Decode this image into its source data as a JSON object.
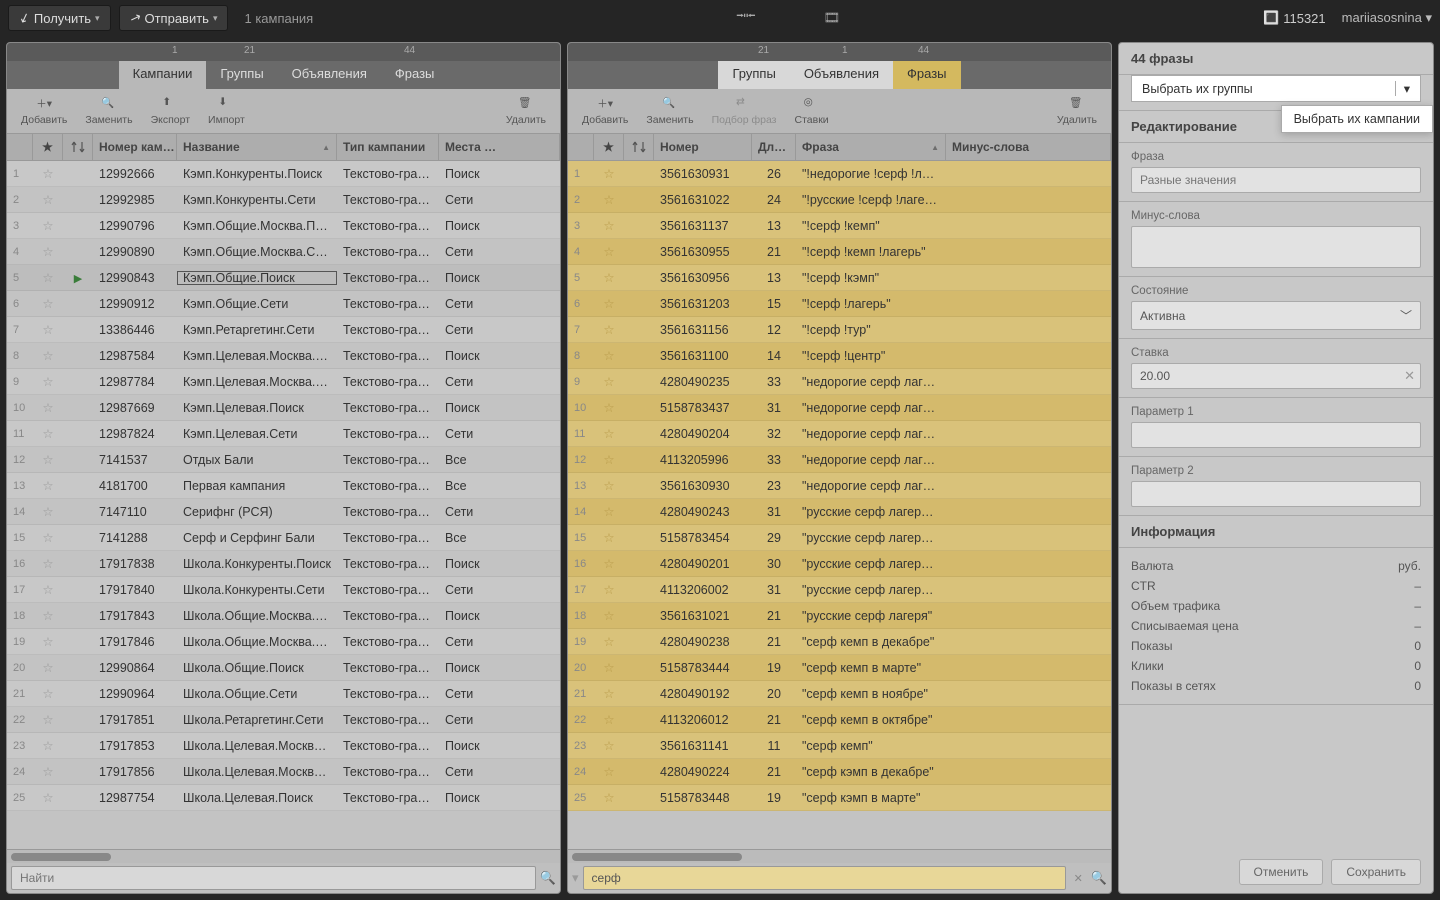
{
  "topbar": {
    "receive": "Получить",
    "send": "Отправить",
    "campaigns_label": "1 кампания",
    "balance": "115321",
    "user": "mariiasosnina"
  },
  "left_counts": {
    "c1": "1",
    "c21": "21",
    "c44": "44"
  },
  "mid_counts": {
    "c21": "21",
    "c1": "1",
    "c44": "44"
  },
  "left_tabs": {
    "campaigns": "Кампании",
    "groups": "Группы",
    "ads": "Объявления",
    "phrases": "Фразы"
  },
  "mid_tabs": {
    "groups": "Группы",
    "ads": "Объявления",
    "phrases": "Фразы"
  },
  "tools": {
    "add": "Добавить",
    "replace": "Заменить",
    "export": "Экспорт",
    "import": "Импорт",
    "delete": "Удалить",
    "pick": "Подбор фраз",
    "bids": "Ставки"
  },
  "left_cols": {
    "num": "Номер кам…",
    "name": "Название",
    "type": "Тип кампании",
    "places": "Места …"
  },
  "mid_cols": {
    "num": "Номер",
    "len": "Дл…",
    "phrase": "Фраза",
    "minus": "Минус-слова"
  },
  "left_rows": [
    {
      "n": "1",
      "id": "12992666",
      "name": "Кэмп.Конкуренты.Поиск",
      "type": "Текстово-граф…",
      "place": "Поиск"
    },
    {
      "n": "2",
      "id": "12992985",
      "name": "Кэмп.Конкуренты.Сети",
      "type": "Текстово-граф…",
      "place": "Сети"
    },
    {
      "n": "3",
      "id": "12990796",
      "name": "Кэмп.Общие.Москва.П…",
      "type": "Текстово-граф…",
      "place": "Поиск"
    },
    {
      "n": "4",
      "id": "12990890",
      "name": "Кэмп.Общие.Москва.С…",
      "type": "Текстово-граф…",
      "place": "Сети"
    },
    {
      "n": "5",
      "id": "12990843",
      "name": "Кэмп.Общие.Поиск",
      "type": "Текстово-граф…",
      "place": "Поиск",
      "sel": true
    },
    {
      "n": "6",
      "id": "12990912",
      "name": "Кэмп.Общие.Сети",
      "type": "Текстово-граф…",
      "place": "Сети"
    },
    {
      "n": "7",
      "id": "13386446",
      "name": "Кэмп.Ретаргетинг.Сети",
      "type": "Текстово-граф…",
      "place": "Сети"
    },
    {
      "n": "8",
      "id": "12987584",
      "name": "Кэмп.Целевая.Москва.…",
      "type": "Текстово-граф…",
      "place": "Поиск"
    },
    {
      "n": "9",
      "id": "12987784",
      "name": "Кэмп.Целевая.Москва.…",
      "type": "Текстово-граф…",
      "place": "Сети"
    },
    {
      "n": "10",
      "id": "12987669",
      "name": "Кэмп.Целевая.Поиск",
      "type": "Текстово-граф…",
      "place": "Поиск"
    },
    {
      "n": "11",
      "id": "12987824",
      "name": "Кэмп.Целевая.Сети",
      "type": "Текстово-граф…",
      "place": "Сети"
    },
    {
      "n": "12",
      "id": "7141537",
      "name": "Отдых Бали",
      "type": "Текстово-граф…",
      "place": "Все"
    },
    {
      "n": "13",
      "id": "4181700",
      "name": "Первая кампания",
      "type": "Текстово-граф…",
      "place": "Все"
    },
    {
      "n": "14",
      "id": "7147110",
      "name": "Серифнг (РСЯ)",
      "type": "Текстово-граф…",
      "place": "Сети"
    },
    {
      "n": "15",
      "id": "7141288",
      "name": "Серф и Серфинг Бали",
      "type": "Текстово-граф…",
      "place": "Все"
    },
    {
      "n": "16",
      "id": "17917838",
      "name": "Школа.Конкуренты.Поиск",
      "type": "Текстово-граф…",
      "place": "Поиск"
    },
    {
      "n": "17",
      "id": "17917840",
      "name": "Школа.Конкуренты.Сети",
      "type": "Текстово-граф…",
      "place": "Сети"
    },
    {
      "n": "18",
      "id": "17917843",
      "name": "Школа.Общие.Москва.…",
      "type": "Текстово-граф…",
      "place": "Поиск"
    },
    {
      "n": "19",
      "id": "17917846",
      "name": "Школа.Общие.Москва.…",
      "type": "Текстово-граф…",
      "place": "Сети"
    },
    {
      "n": "20",
      "id": "12990864",
      "name": "Школа.Общие.Поиск",
      "type": "Текстово-граф…",
      "place": "Поиск"
    },
    {
      "n": "21",
      "id": "12990964",
      "name": "Школа.Общие.Сети",
      "type": "Текстово-граф…",
      "place": "Сети"
    },
    {
      "n": "22",
      "id": "17917851",
      "name": "Школа.Ретаргетинг.Сети",
      "type": "Текстово-граф…",
      "place": "Сети"
    },
    {
      "n": "23",
      "id": "17917853",
      "name": "Школа.Целевая.Москва…",
      "type": "Текстово-граф…",
      "place": "Поиск"
    },
    {
      "n": "24",
      "id": "17917856",
      "name": "Школа.Целевая.Москва…",
      "type": "Текстово-граф…",
      "place": "Сети"
    },
    {
      "n": "25",
      "id": "12987754",
      "name": "Школа.Целевая.Поиск",
      "type": "Текстово-граф…",
      "place": "Поиск"
    }
  ],
  "mid_rows": [
    {
      "n": "1",
      "id": "3561630931",
      "len": "26",
      "phrase": "\"!недорогие !серф !лаге…"
    },
    {
      "n": "2",
      "id": "3561631022",
      "len": "24",
      "phrase": "\"!русские !серф !лагеря\""
    },
    {
      "n": "3",
      "id": "3561631137",
      "len": "13",
      "phrase": "\"!серф !кемп\""
    },
    {
      "n": "4",
      "id": "3561630955",
      "len": "21",
      "phrase": "\"!серф !кемп !лагерь\""
    },
    {
      "n": "5",
      "id": "3561630956",
      "len": "13",
      "phrase": "\"!серф !кэмп\""
    },
    {
      "n": "6",
      "id": "3561631203",
      "len": "15",
      "phrase": "\"!серф !лагерь\""
    },
    {
      "n": "7",
      "id": "3561631156",
      "len": "12",
      "phrase": "\"!серф !тур\""
    },
    {
      "n": "8",
      "id": "3561631100",
      "len": "14",
      "phrase": "\"!серф !центр\""
    },
    {
      "n": "9",
      "id": "4280490235",
      "len": "33",
      "phrase": "\"недорогие серф лагер…"
    },
    {
      "n": "10",
      "id": "5158783437",
      "len": "31",
      "phrase": "\"недорогие серф лагер…"
    },
    {
      "n": "11",
      "id": "4280490204",
      "len": "32",
      "phrase": "\"недорогие серф лагер…"
    },
    {
      "n": "12",
      "id": "4113205996",
      "len": "33",
      "phrase": "\"недорогие серф лагер…"
    },
    {
      "n": "13",
      "id": "3561630930",
      "len": "23",
      "phrase": "\"недорогие серф лагеря\""
    },
    {
      "n": "14",
      "id": "4280490243",
      "len": "31",
      "phrase": "\"русские серф лагеря в…"
    },
    {
      "n": "15",
      "id": "5158783454",
      "len": "29",
      "phrase": "\"русские серф лагеря в…"
    },
    {
      "n": "16",
      "id": "4280490201",
      "len": "30",
      "phrase": "\"русские серф лагеря в…"
    },
    {
      "n": "17",
      "id": "4113206002",
      "len": "31",
      "phrase": "\"русские серф лагеря в…"
    },
    {
      "n": "18",
      "id": "3561631021",
      "len": "21",
      "phrase": "\"русские серф лагеря\""
    },
    {
      "n": "19",
      "id": "4280490238",
      "len": "21",
      "phrase": "\"серф кемп в декабре\""
    },
    {
      "n": "20",
      "id": "5158783444",
      "len": "19",
      "phrase": "\"серф кемп в марте\""
    },
    {
      "n": "21",
      "id": "4280490192",
      "len": "20",
      "phrase": "\"серф кемп в ноябре\""
    },
    {
      "n": "22",
      "id": "4113206012",
      "len": "21",
      "phrase": "\"серф кемп в октябре\""
    },
    {
      "n": "23",
      "id": "3561631141",
      "len": "11",
      "phrase": "\"серф кемп\""
    },
    {
      "n": "24",
      "id": "4280490224",
      "len": "21",
      "phrase": "\"серф кэмп в декабре\""
    },
    {
      "n": "25",
      "id": "5158783448",
      "len": "19",
      "phrase": "\"серф кэмп в марте\""
    }
  ],
  "left_search": {
    "placeholder": "Найти"
  },
  "mid_search": {
    "value": "серф"
  },
  "right": {
    "header": "44 фразы",
    "dd_trigger": "Выбрать их группы",
    "dd_item": "Выбрать их кампании",
    "edit": "Редактирование",
    "phrase_label": "Фраза",
    "phrase_placeholder": "Разные значения",
    "minus_label": "Минус-слова",
    "state_label": "Состояние",
    "state_value": "Активна",
    "bid_label": "Ставка",
    "bid_value": "20.00",
    "param1": "Параметр 1",
    "param2": "Параметр 2",
    "info": "Информация",
    "rows": [
      {
        "k": "Валюта",
        "v": "руб."
      },
      {
        "k": "CTR",
        "v": "–"
      },
      {
        "k": "Объем трафика",
        "v": "–"
      },
      {
        "k": "Списываемая цена",
        "v": "–"
      },
      {
        "k": "Показы",
        "v": "0"
      },
      {
        "k": "Клики",
        "v": "0"
      },
      {
        "k": "Показы в сетях",
        "v": "0"
      }
    ],
    "cancel": "Отменить",
    "save": "Сохранить"
  }
}
